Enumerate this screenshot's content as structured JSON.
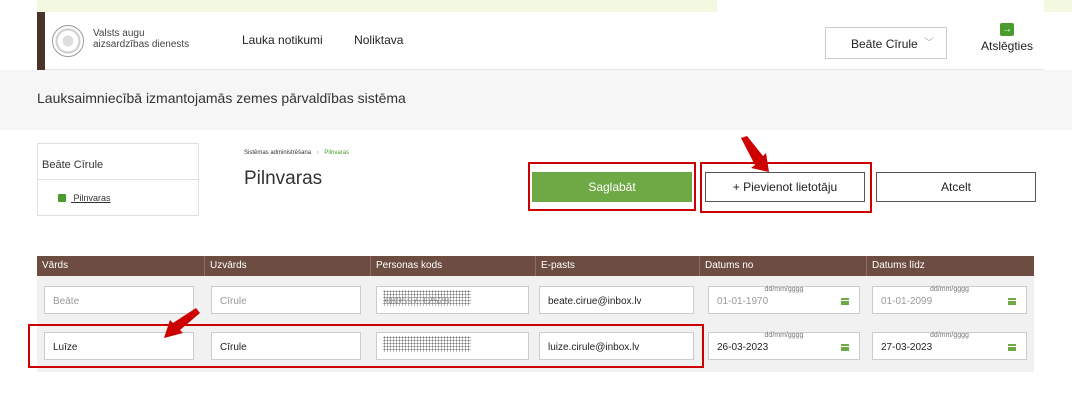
{
  "header": {
    "org_name": "Valsts augu aizsardzības dienests",
    "nav_items": [
      "Lauka notikumi",
      "Noliktava"
    ],
    "user_select": "Beāte Cīrule",
    "logout_label": "Atslēgties"
  },
  "app_title": "Lauksaimniecībā izmantojamās zemes pārvaldības sistēma",
  "sidebar": {
    "user_name": "Beāte Cīrule",
    "items": [
      {
        "label": "Pilnvaras"
      }
    ]
  },
  "breadcrumb": {
    "parent": "Sistēmas administrēšana",
    "separator": "›",
    "current": "Pilnvaras"
  },
  "page_title": "Pilnvaras",
  "buttons": {
    "save": "Saglabāt",
    "add_user": "+ Pievienot lietotāju",
    "cancel": "Atcelt"
  },
  "table": {
    "columns": [
      "Vārds",
      "Uzvārds",
      "Personas kods",
      "E-pasts",
      "Datums no",
      "Datums līdz"
    ],
    "date_placeholder": "dd/mm/gggg",
    "rows": [
      {
        "first_name": "Beāte",
        "last_name": "Cīrule",
        "personal_code": "080597-12528",
        "email": "beate.cirue@inbox.lv",
        "date_from": "01-01-1970",
        "date_to": "01-01-2099"
      },
      {
        "first_name": "Luīze",
        "last_name": "Cīrule",
        "personal_code": "",
        "email": "luize.cirule@inbox.lv",
        "date_from": "26-03-2023",
        "date_to": "27-03-2023"
      }
    ]
  },
  "colors": {
    "brand_brown": "#6d4c41",
    "accent_green": "#6ea945",
    "highlight_red": "#cc0000"
  }
}
